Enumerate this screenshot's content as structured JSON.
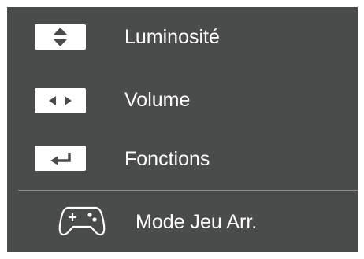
{
  "menu": {
    "items": [
      {
        "label": "Luminosité",
        "icon": "up-down-arrows-icon"
      },
      {
        "label": "Volume",
        "icon": "left-right-arrows-icon"
      },
      {
        "label": "Fonctions",
        "icon": "enter-return-icon"
      }
    ],
    "footer": {
      "label": "Mode Jeu Arr.",
      "icon": "gamepad-icon"
    }
  },
  "colors": {
    "panel_background": "#4a4b4b",
    "key_background": "#ffffff",
    "key_glyph": "#4a4b4b",
    "text": "#ffffff",
    "divider": "#8c8c8c"
  }
}
